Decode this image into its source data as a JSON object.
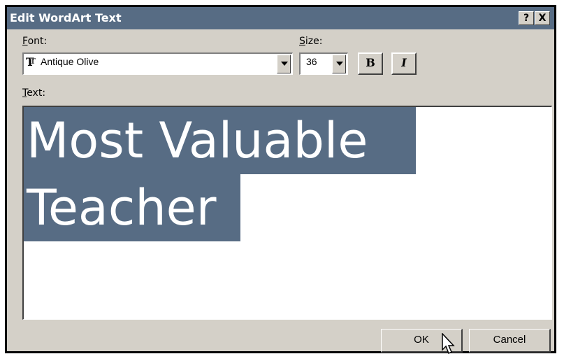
{
  "window": {
    "title": "Edit WordArt Text",
    "help_label": "?",
    "close_label": "X"
  },
  "font": {
    "label_access": "F",
    "label_rest": "ont:",
    "value": "Antique Olive",
    "icon": "truetype-font-icon"
  },
  "size": {
    "label_access": "S",
    "label_rest": "ize:",
    "value": "36"
  },
  "format": {
    "bold_label": "B",
    "italic_label": "I"
  },
  "text": {
    "label_access": "T",
    "label_rest": "ext:",
    "line1": "Most Valuable ",
    "line2": "Teacher"
  },
  "buttons": {
    "ok_label": "OK",
    "cancel_label": "Cancel"
  },
  "colors": {
    "titlebar": "#576c84",
    "selection": "#576c84",
    "face": "#d4d0c8"
  }
}
